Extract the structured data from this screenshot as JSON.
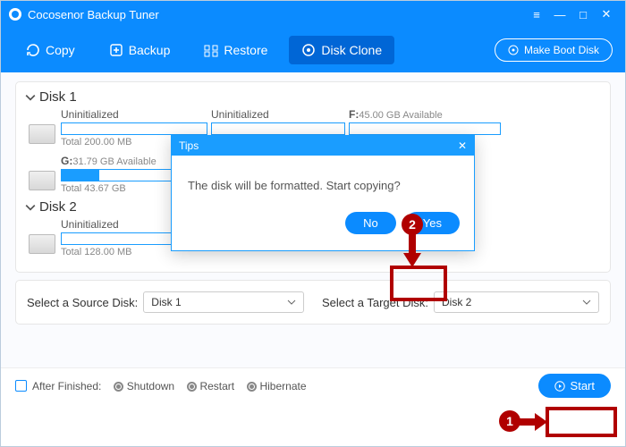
{
  "app": {
    "title": "Cocosenor Backup Tuner"
  },
  "toolbar": {
    "copy": "Copy",
    "backup": "Backup",
    "restore": "Restore",
    "clone": "Disk Clone",
    "makeboot": "Make Boot Disk"
  },
  "disks": {
    "d1_title": "Disk 1",
    "d2_title": "Disk 2",
    "d1_parts": [
      {
        "label": "Uninitialized",
        "size": "",
        "total": "Total 200.00 MB",
        "fill": "0%"
      },
      {
        "label": "Uninitialized",
        "size": "",
        "total": "",
        "fill": "0%"
      },
      {
        "label": "F:",
        "size": "45.00 GB Available",
        "total": "",
        "fill": "0%"
      },
      {
        "label": "G:",
        "size": "31.79 GB Available",
        "total": "Total 43.67 GB",
        "fill": "26%"
      }
    ],
    "d2_parts": [
      {
        "label": "Uninitialized",
        "size": "",
        "total": "Total 128.00 MB",
        "fill": "0%"
      }
    ]
  },
  "selectors": {
    "source_label": "Select a Source Disk:",
    "source_value": "Disk 1",
    "target_label": "Select a Target Disk:",
    "target_value": "Disk 2"
  },
  "footer": {
    "after_label": "After Finished:",
    "opt_shutdown": "Shutdown",
    "opt_restart": "Restart",
    "opt_hibernate": "Hibernate",
    "start": "Start"
  },
  "modal": {
    "title": "Tips",
    "message": "The disk will be formatted. Start copying?",
    "no": "No",
    "yes": "Yes"
  },
  "annot": {
    "n1": "1",
    "n2": "2"
  }
}
